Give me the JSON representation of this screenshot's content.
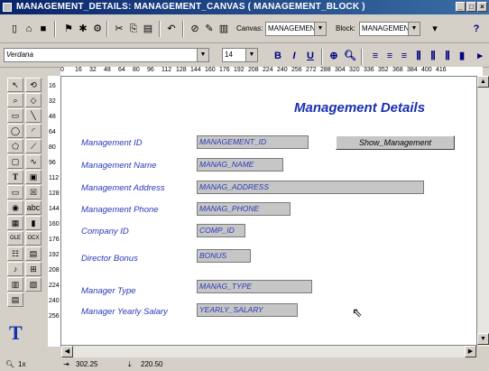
{
  "window": {
    "title": "MANAGEMENT_DETAILS: MANAGEMENT_CANVAS ( MANAGEMENT_BLOCK )"
  },
  "toolbar": {
    "canvas_label": "Canvas:",
    "canvas_value": "MANAGEMEN",
    "block_label": "Block:",
    "block_value": "MANAGEMEN",
    "help_glyph": "?",
    "font_value": "Verdana",
    "font_size": "14",
    "bold": "B",
    "italic": "I",
    "underline": "U"
  },
  "ruler": {
    "horizontal": [
      "0",
      "16",
      "32",
      "48",
      "64",
      "80",
      "96",
      "112",
      "128",
      "144",
      "160",
      "176",
      "192",
      "208",
      "224",
      "240",
      "256",
      "272",
      "288",
      "304",
      "320",
      "336",
      "352",
      "368",
      "384",
      "400",
      "416"
    ],
    "vertical": [
      "16",
      "32",
      "48",
      "64",
      "80",
      "96",
      "112",
      "128",
      "144",
      "160",
      "176",
      "192",
      "208",
      "224",
      "240",
      "256"
    ]
  },
  "form": {
    "heading": "Management Details",
    "show_button": "Show_Management",
    "fields": [
      {
        "label": "Management ID",
        "value": "MANAGEMENT_ID"
      },
      {
        "label": "Management Name",
        "value": "MANAG_NAME"
      },
      {
        "label": "Management Address",
        "value": "MANAG_ADDRESS"
      },
      {
        "label": "Management Phone",
        "value": "MANAG_PHONE"
      },
      {
        "label": "Company ID",
        "value": "COMP_ID"
      },
      {
        "label": "Director Bonus",
        "value": "BONUS"
      },
      {
        "label": "Manager Type",
        "value": "MANAG_TYPE"
      },
      {
        "label": "Manager Yearly Salary",
        "value": "YEARLY_SALARY"
      }
    ]
  },
  "status": {
    "zoom": "1x",
    "x": "302.25",
    "y": "220.50"
  }
}
